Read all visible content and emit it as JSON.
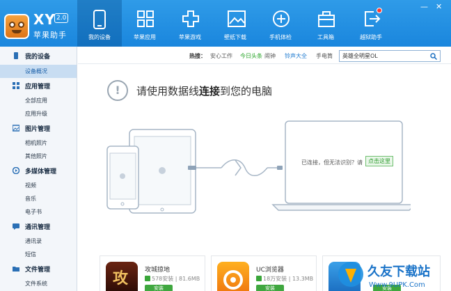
{
  "brand": {
    "title": "XY",
    "version": "2.0",
    "subtitle": "苹果助手"
  },
  "nav": [
    {
      "label": "我的设备",
      "icon": "phone-icon"
    },
    {
      "label": "苹果应用",
      "icon": "grid-icon"
    },
    {
      "label": "苹果游戏",
      "icon": "gamepad-icon"
    },
    {
      "label": "壁纸下载",
      "icon": "image-icon"
    },
    {
      "label": "手机体检",
      "icon": "plus-circle-icon"
    },
    {
      "label": "工具箱",
      "icon": "toolbox-icon"
    },
    {
      "label": "越狱助手",
      "icon": "exit-icon"
    }
  ],
  "sidebar": {
    "sections": [
      {
        "title": "我的设备",
        "items": [
          "设备概况"
        ]
      },
      {
        "title": "应用管理",
        "items": [
          "全部应用",
          "应用升级"
        ]
      },
      {
        "title": "图片管理",
        "items": [
          "相机照片",
          "其他照片"
        ]
      },
      {
        "title": "多媒体管理",
        "items": [
          "视频",
          "音乐",
          "电子书"
        ]
      },
      {
        "title": "通讯管理",
        "items": [
          "通讯录",
          "短信"
        ]
      },
      {
        "title": "文件管理",
        "items": [
          "文件系统"
        ]
      }
    ]
  },
  "hotbar": {
    "label": "热搜：",
    "items": [
      "安心工作",
      "今日头条",
      "闹钟",
      "铃声大全",
      "手电筒"
    ]
  },
  "search": {
    "value": "英雄全明星OL"
  },
  "connect": {
    "title_pre": "请使用数据线",
    "title_bold": "连接",
    "title_post": "到您的电脑",
    "unrecognized": "已连接，但无法识别？请",
    "click_here": "点击这里"
  },
  "apps": [
    {
      "name": "攻城掠地",
      "meta": "578安装 | 81.6MB",
      "install": "安装",
      "icon_char": "攻"
    },
    {
      "name": "UC浏览器",
      "meta": "18万安装 | 13.3MB",
      "install": "安装"
    },
    {
      "install": "安装"
    }
  ],
  "watermark": {
    "text": "久友下载站",
    "url": "Www.9UPK.Com"
  },
  "window_controls": {
    "min": "—",
    "close": "✕"
  },
  "colors": {
    "header": "#2f9be8",
    "accent_green": "#3fa73f",
    "link_blue": "#1f7bd0"
  }
}
